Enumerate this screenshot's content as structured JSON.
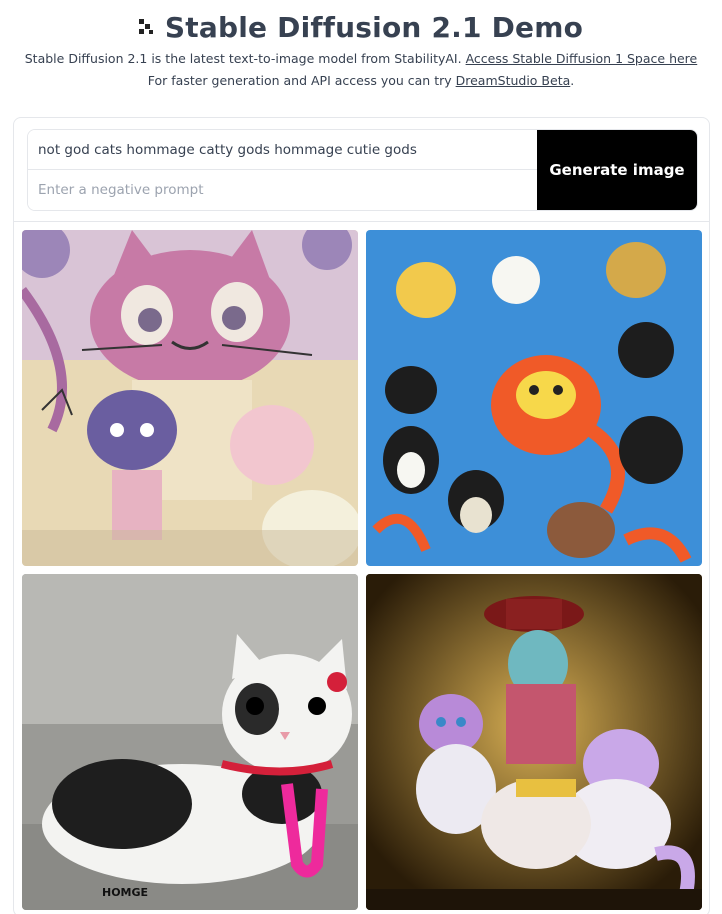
{
  "header": {
    "title": "Stable Diffusion 2.1 Demo",
    "subtitle_line1": "Stable Diffusion 2.1 is the latest text-to-image model from StabilityAI.",
    "link1_label": "Access Stable Diffusion 1 Space here",
    "subtitle_line2_prefix": "For faster generation and API access you can try",
    "link2_label": "DreamStudio Beta",
    "subtitle_line2_suffix": "."
  },
  "form": {
    "prompt_value": "not god cats hommage catty gods hommage cutie gods",
    "negative_placeholder": "Enter a negative prompt",
    "generate_label": "Generate image"
  },
  "gallery": {
    "images": [
      {
        "alt": "pink cartoon cat with small cats"
      },
      {
        "alt": "many cats pattern on blue background"
      },
      {
        "alt": "white and black kitten with pink toy"
      },
      {
        "alt": "fantasy cats in ornate golden scene"
      }
    ],
    "caption_text": "HOMGE"
  }
}
